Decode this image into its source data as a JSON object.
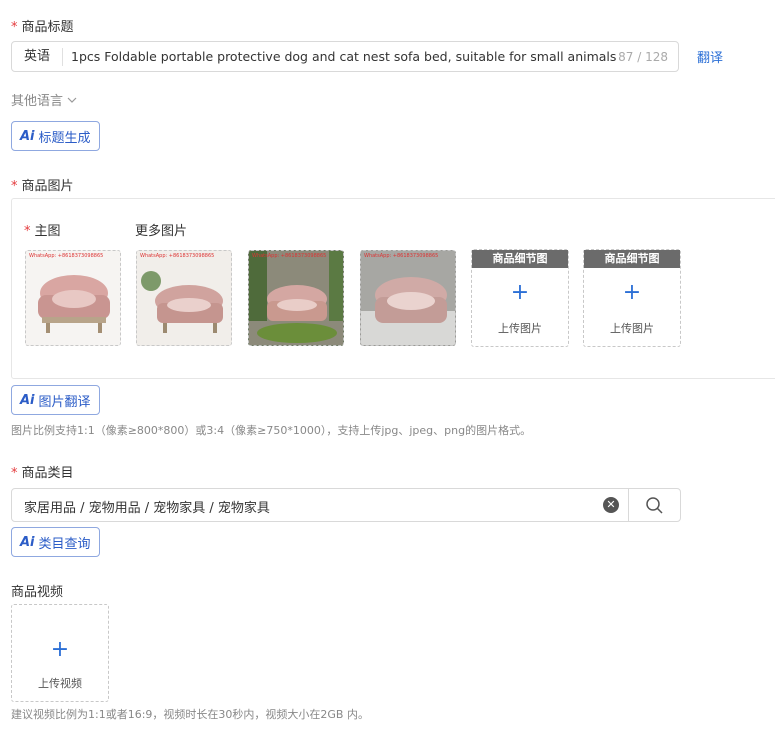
{
  "title_section": {
    "required_mark": "*",
    "label": "商品标题",
    "language": "英语",
    "value": "1pcs Foldable portable protective dog and cat nest sofa bed, suitable for small animals",
    "counter": "87 / 128",
    "translate_link": "翻译",
    "other_languages": "其他语言",
    "ai_button": "标题生成"
  },
  "image_section": {
    "required_mark": "*",
    "label": "商品图片",
    "main_label": "主图",
    "more_label": "更多图片",
    "watermark": "WhatsApp: +8618373098865",
    "detail_header_1": "商品细节图",
    "detail_header_2": "商品细节图",
    "upload_label_1": "上传图片",
    "upload_label_2": "上传图片",
    "ai_button": "图片翻译",
    "hint": "图片比例支持1:1（像素≥800*800）或3:4（像素≥750*1000），支持上传jpg、jpeg、png的图片格式。"
  },
  "category_section": {
    "required_mark": "*",
    "label": "商品类目",
    "value": "家居用品 / 宠物用品 / 宠物家具 / 宠物家具",
    "ai_button": "类目查询"
  },
  "video_section": {
    "label": "商品视频",
    "upload_label": "上传视频",
    "hint": "建议视频比例为1:1或者16:9，视频时长在30秒内，视频大小在2GB 内。"
  },
  "ai_mark": "Ai",
  "icons": [
    "chevron-down-icon",
    "plus-icon",
    "clear-icon",
    "search-icon"
  ],
  "colors": {
    "accent": "#2b6fd6",
    "required": "#e4393c",
    "ai": "#2b5cc7"
  }
}
